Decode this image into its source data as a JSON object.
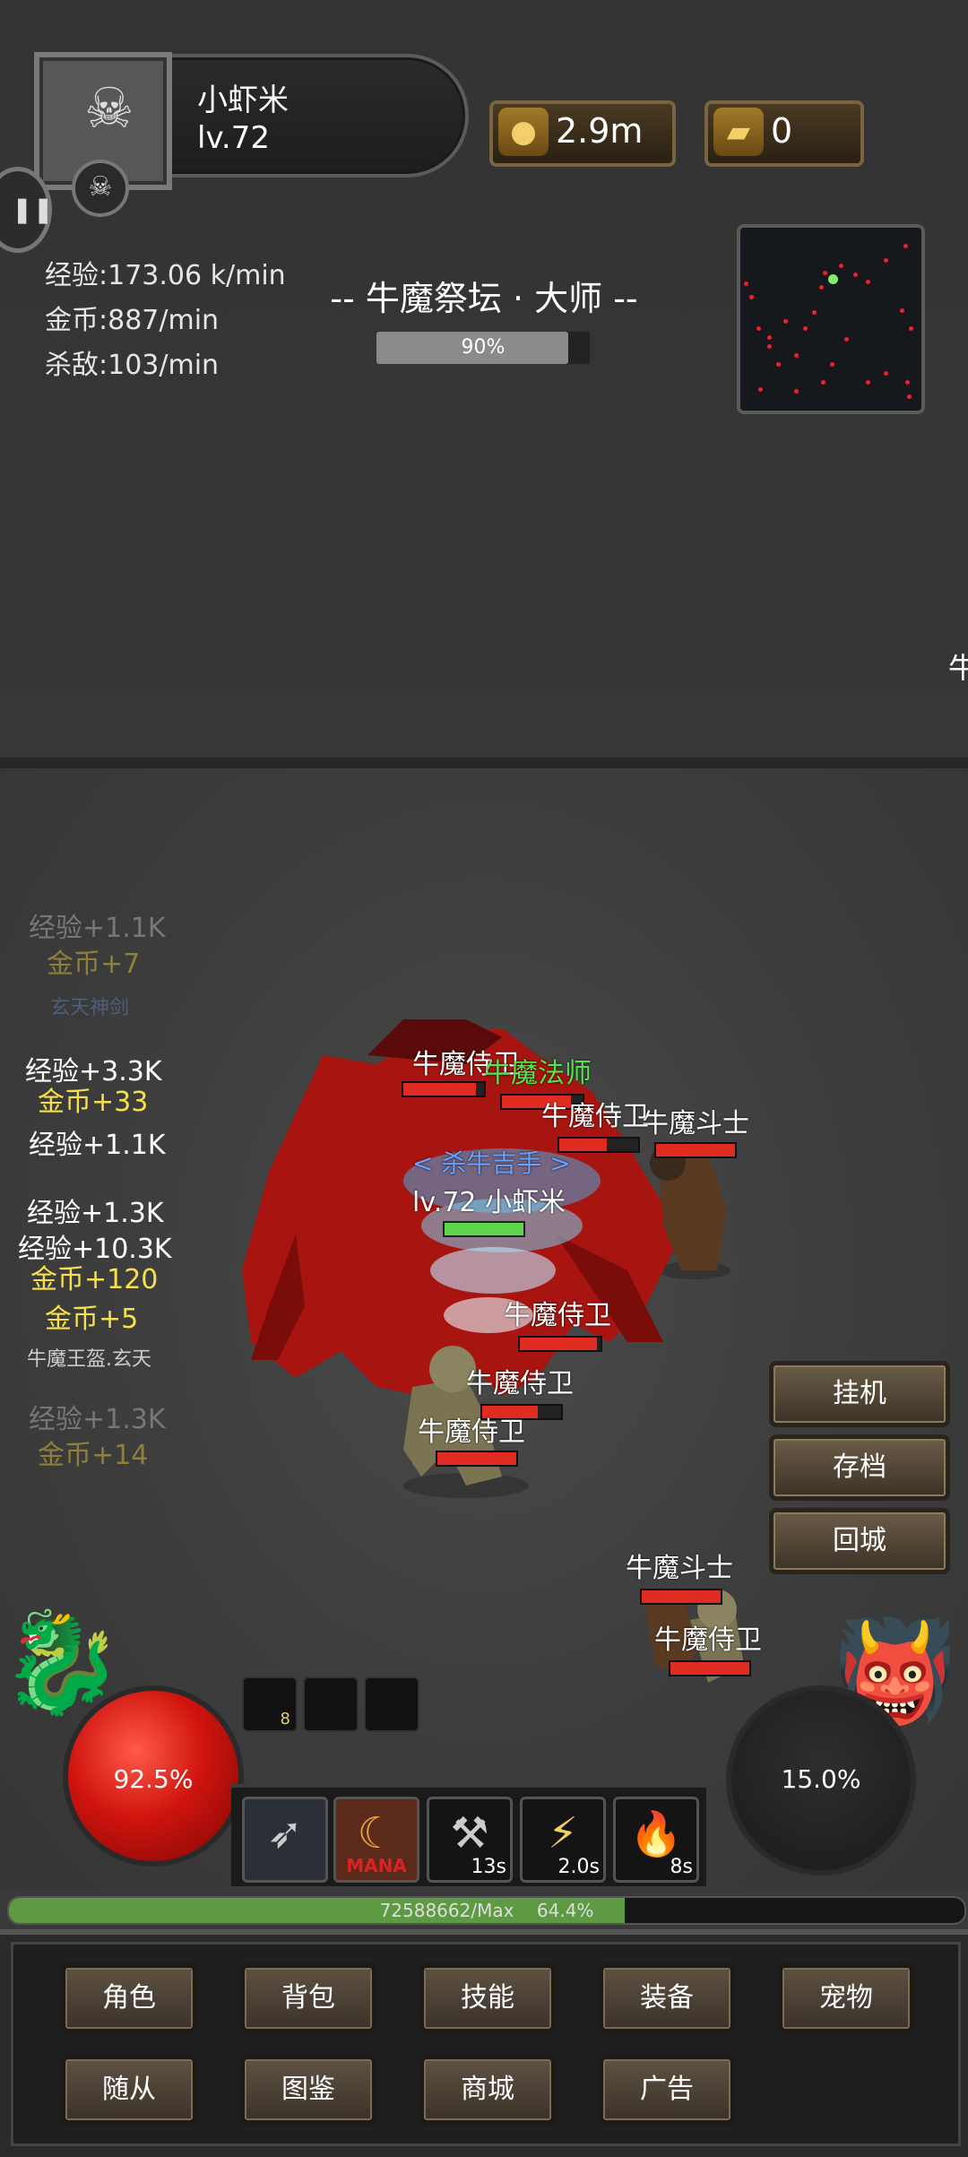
{
  "player": {
    "name": "小虾米",
    "level": "lv.72"
  },
  "resources": {
    "gold": "2.9m",
    "ingots": "0"
  },
  "rates": {
    "exp": "经验:173.06 k/min",
    "gold": "金币:887/min",
    "kills": "杀敌:103/min"
  },
  "stage": {
    "title": "-- 牛魔祭坛 · 大师 --",
    "progress_label": "90%",
    "progress": 0.9
  },
  "offscreen_label": "牛",
  "combat_log": [
    {
      "text": "经验+1.1K",
      "style": "faded"
    },
    {
      "text": "金币+7",
      "style": "faded-gold"
    },
    {
      "text": "玄天神剑",
      "style": "item-dim"
    },
    {
      "text": "经验+3.3K",
      "style": "normal"
    },
    {
      "text": "金币+33",
      "style": "gold"
    },
    {
      "text": "经验+1.1K",
      "style": "normal"
    },
    {
      "text": "经验+1.3K",
      "style": "normal"
    },
    {
      "text": "经验+10.3K",
      "style": "normal"
    },
    {
      "text": "金币+120",
      "style": "gold"
    },
    {
      "text": "金币+5",
      "style": "gold"
    },
    {
      "text": "牛魔王盔.玄天",
      "style": "item"
    },
    {
      "text": "经验+1.3K",
      "style": "faded"
    },
    {
      "text": "金币+14",
      "style": "faded-gold"
    }
  ],
  "battle": {
    "player_label": "lv.72 小虾米",
    "kill_text": "< 杀牛吉手 >",
    "mobs": [
      {
        "name": "牛魔侍卫",
        "color": "white",
        "hp": 0.9
      },
      {
        "name": "牛魔法师",
        "color": "green",
        "hp": 0.85
      },
      {
        "name": "牛魔斗士",
        "color": "white",
        "hp": 1.0
      },
      {
        "name": "牛魔侍卫",
        "color": "white",
        "hp": 0.6
      },
      {
        "name": "牛魔侍卫",
        "color": "white",
        "hp": 0.95
      },
      {
        "name": "牛魔侍卫",
        "color": "white",
        "hp": 0.7
      },
      {
        "name": "牛魔侍卫",
        "color": "white",
        "hp": 1.0
      },
      {
        "name": "牛魔斗士",
        "color": "white",
        "hp": 1.0
      },
      {
        "name": "牛魔侍卫",
        "color": "white",
        "hp": 1.0
      }
    ]
  },
  "side_buttons": {
    "idle": "挂机",
    "save": "存档",
    "return": "回城"
  },
  "orbs": {
    "hp": "92.5%",
    "mp": "15.0%"
  },
  "cooldown_slots": [
    "8",
    "",
    ""
  ],
  "skills": [
    {
      "icon": "dash-skill-icon",
      "cd": ""
    },
    {
      "icon": "mana-skill-icon",
      "label": "MANA",
      "cd": ""
    },
    {
      "icon": "axe-skill-icon",
      "cd": "13s"
    },
    {
      "icon": "lightning-skill-icon",
      "cd": "2.0s"
    },
    {
      "icon": "fire-skill-icon",
      "cd": "8s"
    }
  ],
  "exp": {
    "text": "72588662/Max",
    "percent_label": "64.4%",
    "progress": 0.644
  },
  "menu": {
    "row1": [
      "角色",
      "背包",
      "技能",
      "装备",
      "宠物"
    ],
    "row2": [
      "随从",
      "图鉴",
      "商城",
      "广告"
    ]
  },
  "colors": {
    "hp_bar": "#e02b22",
    "exp_fill": "#5e9a44",
    "mob_green": "#59e24a",
    "gold_text": "#f6e14a"
  }
}
